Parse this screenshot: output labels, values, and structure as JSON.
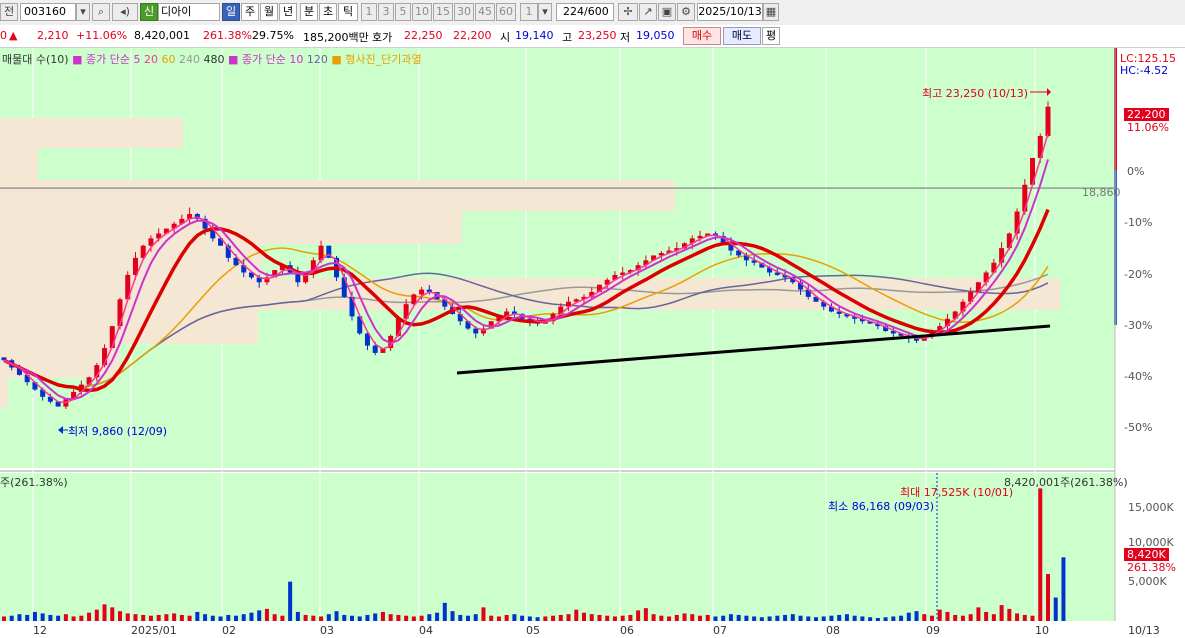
{
  "toolbar": {
    "market_label": "전",
    "stock_code": "003160",
    "shin_badge": "신",
    "stock_name": "디아이",
    "period_day": "일",
    "period_week": "주",
    "period_month": "월",
    "period_year": "년",
    "period_minute": "분",
    "period_second": "초",
    "period_tick": "틱",
    "intervals": [
      "1",
      "3",
      "5",
      "10",
      "15",
      "30",
      "45",
      "60"
    ],
    "interval_value": "1",
    "count_value": "224",
    "count_total": "/600",
    "date_value": "2025/10/13"
  },
  "info": {
    "prefix": "0",
    "change_arrow": "▲",
    "change": "2,210",
    "change_pct": "+11.06%",
    "volume": "8,420,001",
    "volume_ratio": "261.38%",
    "turnover": "29.75%",
    "amount": "185,200백만",
    "ask_label": "호가",
    "ask1": "22,250",
    "ask2": "22,200",
    "open_label": "시",
    "open": "19,140",
    "high_label": "고",
    "high": "23,250",
    "low_label": "저",
    "low": "19,050",
    "buy_label": "매수",
    "sell_label": "매도",
    "flat_label": "평"
  },
  "legend": {
    "volume_profile": "매물대 수(10)",
    "ma_price_label": "종가 단순 5",
    "ma20": "20",
    "ma60": "60",
    "ma240": "240",
    "ma480": "480",
    "ma_price_label2": "종가 단순 10",
    "ma120": "120",
    "pattern": "형사진_단기과열",
    "volume_panel": "주(261.38%)"
  },
  "annotations": {
    "high_label": "최고 23,250 (10/13)",
    "low_label": "최저 9,860 (12/09)",
    "ref_price": "18,860",
    "lc": "LC:125.15",
    "hc": "HC:-4.52",
    "last_price": "22,200",
    "last_pct": "11.06%",
    "vol_max_label": "최대 17,525K (10/01)",
    "vol_min_label": "최소 86,168 (09/03)",
    "vol_last_label": "8,420,001주(261.38%)",
    "vol_last_badge": "8,420K",
    "vol_last_pct": "261.38%"
  },
  "y_axis_labels": [
    "0%",
    "-10%",
    "-20%",
    "-30%",
    "-40%",
    "-50%"
  ],
  "vol_axis_labels": [
    "15,000K",
    "10,000K",
    "5,000K"
  ],
  "x_axis_labels": [
    "12",
    "2025/01",
    "02",
    "03",
    "04",
    "05",
    "06",
    "07",
    "08",
    "09",
    "10",
    "10/13"
  ],
  "colors": {
    "chart_bg": "#ccffcc",
    "up": "#e2001a",
    "down": "#0033cc",
    "ma5": "#cc33cc",
    "ma10": "#dd0000",
    "ma20": "#ff3399",
    "ma60": "#e8a000",
    "ma120": "#666699",
    "ma240": "#999999",
    "trendline": "#000000",
    "profile": "#f5e6d3"
  },
  "chart_data": {
    "type": "candlestick",
    "price_range": [
      9860,
      23250
    ],
    "high": {
      "price": 23250,
      "date": "10/13"
    },
    "low": {
      "price": 9860,
      "date": "12/09"
    },
    "reference_price": 18860,
    "close": [
      11800,
      11500,
      11200,
      10900,
      10600,
      10300,
      10100,
      9900,
      10200,
      10500,
      10800,
      11100,
      11600,
      12300,
      13200,
      14300,
      15300,
      16000,
      16500,
      16800,
      17000,
      17200,
      17400,
      17600,
      17800,
      17600,
      17200,
      16800,
      16500,
      16000,
      15700,
      15400,
      15200,
      15000,
      15200,
      15500,
      15700,
      15400,
      15000,
      15400,
      15900,
      16500,
      16000,
      15200,
      14400,
      13600,
      12900,
      12400,
      12100,
      12300,
      12800,
      13500,
      14100,
      14500,
      14700,
      14600,
      14300,
      14000,
      13700,
      13400,
      13100,
      12900,
      13100,
      13400,
      13600,
      13800,
      13700,
      13500,
      13400,
      13300,
      13400,
      13700,
      14000,
      14200,
      14300,
      14400,
      14600,
      14900,
      15100,
      15300,
      15400,
      15500,
      15700,
      15900,
      16100,
      16200,
      16300,
      16400,
      16600,
      16800,
      16900,
      17000,
      16900,
      16600,
      16300,
      16100,
      15900,
      15800,
      15600,
      15400,
      15300,
      15200,
      15000,
      14700,
      14400,
      14200,
      14000,
      13800,
      13700,
      13600,
      13500,
      13400,
      13300,
      13200,
      13000,
      12900,
      12800,
      12700,
      12600,
      12800,
      13000,
      13200,
      13500,
      13800,
      14200,
      14600,
      15000,
      15400,
      15800,
      16400,
      17000,
      17900,
      19000,
      20100,
      21000,
      22200
    ],
    "volume_k": [
      600,
      700,
      900,
      800,
      1200,
      1000,
      800,
      700,
      900,
      600,
      700,
      1100,
      1500,
      2200,
      1800,
      1300,
      1000,
      900,
      800,
      700,
      800,
      900,
      1000,
      800,
      700,
      1200,
      900,
      700,
      600,
      800,
      700,
      900,
      1100,
      1400,
      1600,
      900,
      700,
      5200,
      1200,
      800,
      700,
      600,
      900,
      1300,
      800,
      700,
      600,
      800,
      1000,
      1200,
      900,
      800,
      700,
      600,
      700,
      900,
      1100,
      2400,
      1300,
      800,
      700,
      900,
      1800,
      700,
      600,
      800,
      900,
      700,
      600,
      500,
      600,
      700,
      800,
      900,
      1500,
      1100,
      900,
      800,
      700,
      600,
      700,
      800,
      1400,
      1700,
      900,
      700,
      600,
      800,
      1000,
      900,
      700,
      800,
      600,
      700,
      900,
      800,
      700,
      600,
      500,
      600,
      700,
      800,
      900,
      700,
      600,
      500,
      600,
      700,
      800,
      900,
      700,
      600,
      500,
      400,
      500,
      600,
      700,
      1100,
      1300,
      900,
      700,
      1500,
      1200,
      800,
      700,
      900,
      1800,
      1200,
      900,
      2100,
      1600,
      1000,
      800,
      700,
      17525,
      6200,
      3100,
      8420
    ]
  }
}
